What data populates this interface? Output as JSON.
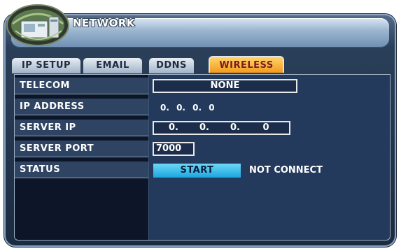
{
  "window": {
    "title": "NETWORK"
  },
  "tabs": [
    {
      "label": "IP SETUP",
      "active": false
    },
    {
      "label": "EMAIL",
      "active": false
    },
    {
      "label": "DDNS",
      "active": false
    },
    {
      "label": "WIRELESS",
      "active": true
    }
  ],
  "fields": {
    "telecom": {
      "label": "TELECOM",
      "value": "NONE"
    },
    "ip_address": {
      "label": "IP ADDRESS",
      "value": "0. 0. 0. 0"
    },
    "server_ip": {
      "label": "SERVER IP",
      "octets": [
        "0.",
        "0.",
        "0.",
        "0"
      ]
    },
    "server_port": {
      "label": "SERVER PORT",
      "value": "7000"
    },
    "status": {
      "label": "STATUS",
      "button_label": "START",
      "state_text": "NOT CONNECT"
    }
  },
  "colors": {
    "active_tab": "#f49a1c",
    "start_button": "#1ba7e0",
    "panel_bg": "#243a5c"
  },
  "icons": {
    "badge": "network-device-icon"
  }
}
